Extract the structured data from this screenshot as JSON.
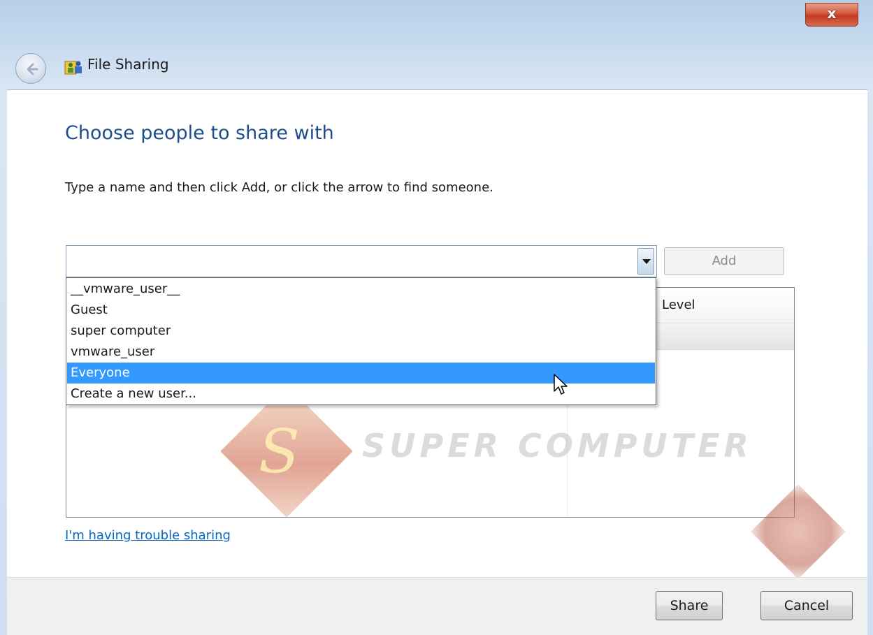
{
  "window": {
    "title": "File Sharing",
    "close_label": "x"
  },
  "main": {
    "heading": "Choose people to share with",
    "instruction": "Type a name and then click Add, or click the arrow to find someone.",
    "name_input_value": "",
    "add_label": "Add",
    "permission_column": "Level",
    "dropdown_items": [
      "__vmware_user__",
      "Guest",
      "super computer",
      "vmware_user",
      "Everyone",
      "Create a new user..."
    ],
    "selected_item": "Everyone",
    "trouble_link": "I'm having trouble sharing"
  },
  "footer": {
    "share_label": "Share",
    "cancel_label": "Cancel"
  },
  "watermark": {
    "letter": "S",
    "text": "SUPER COMPUTER"
  },
  "colors": {
    "heading": "#1e4e8c",
    "selection": "#3399ff",
    "link": "#0a66c2",
    "close_button": "#c23a22"
  },
  "icons": {
    "back": "back-arrow-icon",
    "app": "file-sharing-people-icon",
    "dropdown": "chevron-down-icon",
    "cursor": "mouse-pointer-icon"
  }
}
